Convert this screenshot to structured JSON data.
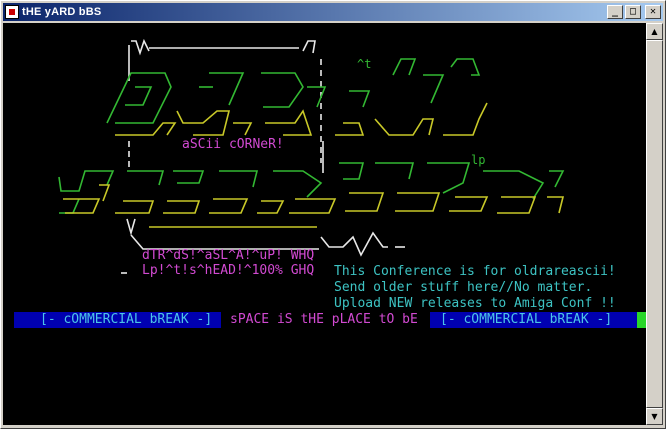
{
  "window": {
    "title": "tHE yARD bBS",
    "controls": {
      "minimize": "_",
      "maximize": "□",
      "close": "✕"
    }
  },
  "art": {
    "corner_label": "aSCii cORNeR!",
    "tag_t": "^t",
    "tag_lp": "lp",
    "credits_line1": "dTR^dS!^aSL^A!^uP! WHQ",
    "credits_line2": "Lp!^t!s^hEAD!^100% GHQ"
  },
  "info": {
    "lines": [
      "This Conference is for oldrareascii!",
      "Send older stuff here//No matter.",
      "Upload NEW releases to Amiga Conf !!"
    ]
  },
  "status_bar": {
    "left_break": "[- cOMMERCIAL bREAK -]",
    "middle": "sPACE iS tHE pLACE tO bE",
    "right_break": "[- cOMMERCIAL bREAK -]"
  },
  "colors": {
    "terminal_bg": "#000000",
    "accent_magenta": "#d24ad2",
    "accent_cyan": "#3dc3c3",
    "ascii_green": "#33b833",
    "ascii_yellow": "#c8c828",
    "bar_blue": "#0000b0",
    "cursor_green": "#29d629"
  }
}
